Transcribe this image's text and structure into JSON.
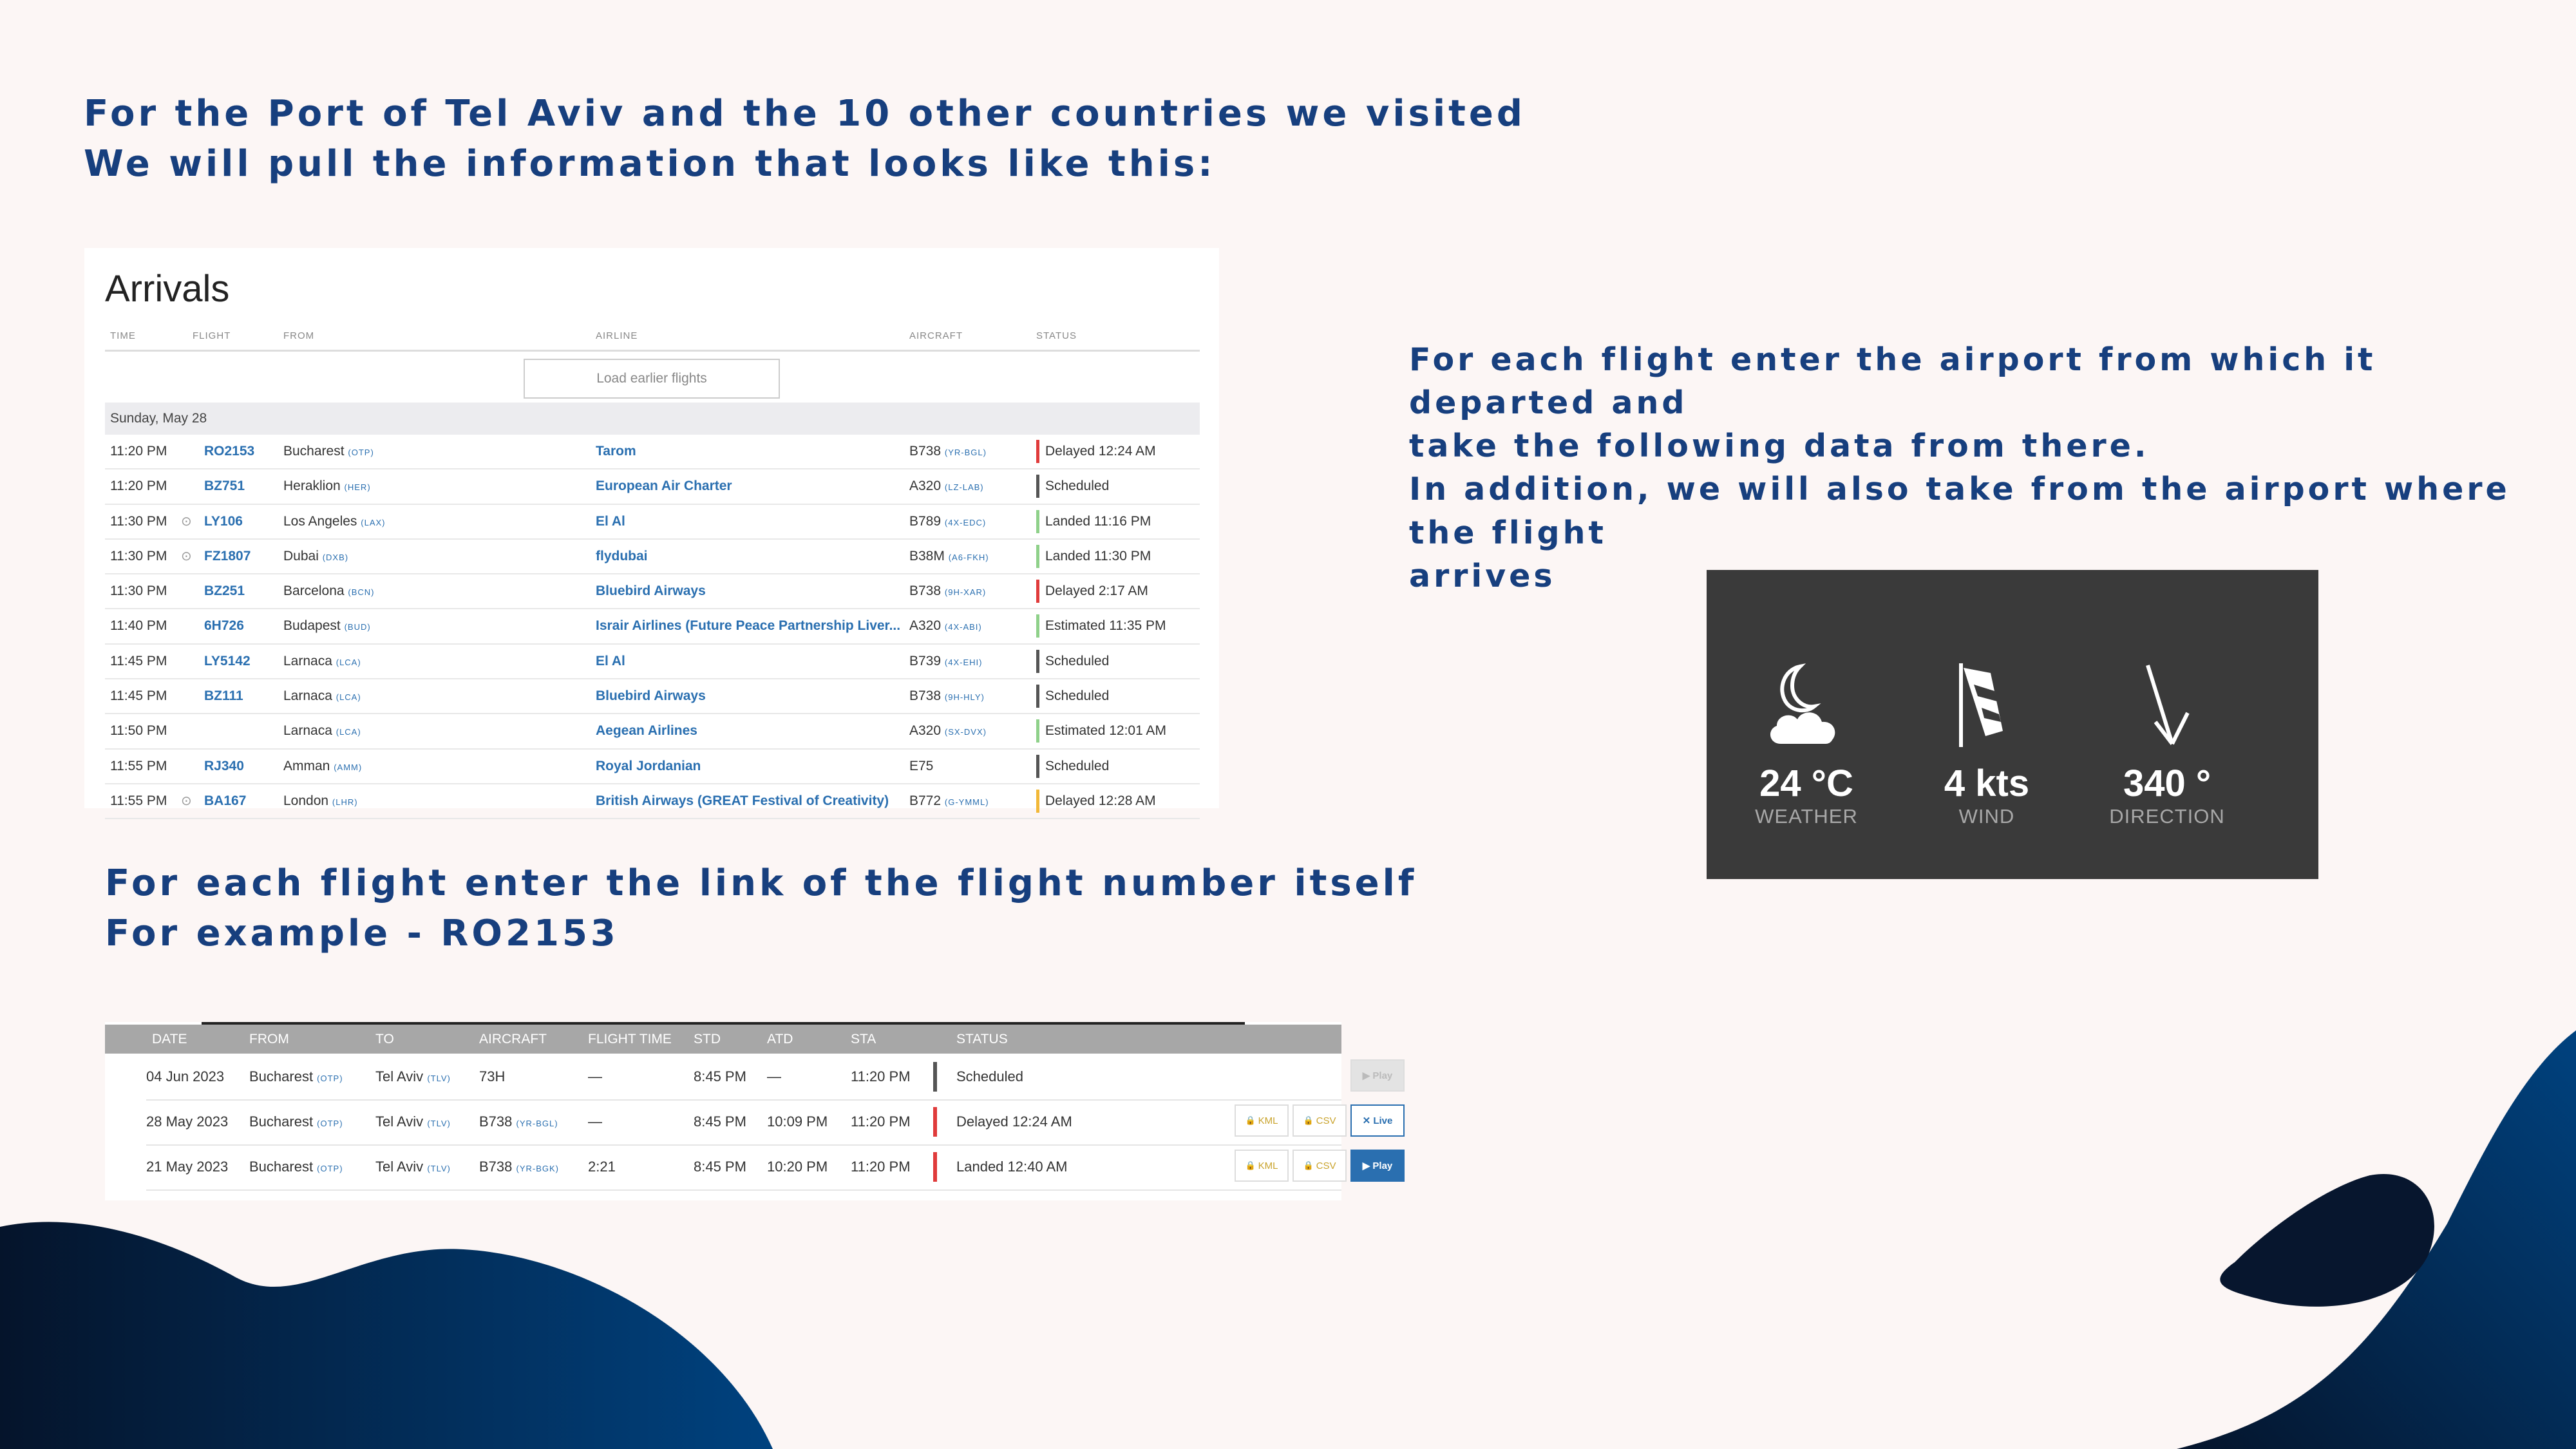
{
  "headings": {
    "top": "For the Port of Tel Aviv and the 10 other countries we visited\nWe will pull the information that looks like this:",
    "middle": "For each flight enter the link of the flight number itself\nFor example - RO2153",
    "right": "For each flight enter the airport from which it departed and\ntake the following data from there.\nIn addition, we will also take from the airport where the flight\narrives"
  },
  "arrivals": {
    "title": "Arrivals",
    "columns": [
      "TIME",
      "FLIGHT",
      "FROM",
      "AIRLINE",
      "AIRCRAFT",
      "STATUS"
    ],
    "load_button": "Load earlier flights",
    "day": "Sunday, May 28",
    "rows": [
      {
        "time": "11:20 PM",
        "live": false,
        "flight": "RO2153",
        "from": "Bucharest",
        "from_code": "(OTP)",
        "airline": "Tarom",
        "aircraft": "B738",
        "reg": "(YR-BGL)",
        "status": "Delayed 12:24 AM",
        "status_color": "#e03b3b"
      },
      {
        "time": "11:20 PM",
        "live": false,
        "flight": "BZ751",
        "from": "Heraklion",
        "from_code": "(HER)",
        "airline": "European Air Charter",
        "aircraft": "A320",
        "reg": "(LZ-LAB)",
        "status": "Scheduled",
        "status_color": "#555555"
      },
      {
        "time": "11:30 PM",
        "live": true,
        "flight": "LY106",
        "from": "Los Angeles",
        "from_code": "(LAX)",
        "airline": "El Al",
        "aircraft": "B789",
        "reg": "(4X-EDC)",
        "status": "Landed 11:16 PM",
        "status_color": "#8fd18a"
      },
      {
        "time": "11:30 PM",
        "live": true,
        "flight": "FZ1807",
        "from": "Dubai",
        "from_code": "(DXB)",
        "airline": "flydubai",
        "aircraft": "B38M",
        "reg": "(A6-FKH)",
        "status": "Landed 11:30 PM",
        "status_color": "#8fd18a"
      },
      {
        "time": "11:30 PM",
        "live": false,
        "flight": "BZ251",
        "from": "Barcelona",
        "from_code": "(BCN)",
        "airline": "Bluebird Airways",
        "aircraft": "B738",
        "reg": "(9H-XAR)",
        "status": "Delayed 2:17 AM",
        "status_color": "#e03b3b"
      },
      {
        "time": "11:40 PM",
        "live": false,
        "flight": "6H726",
        "from": "Budapest",
        "from_code": "(BUD)",
        "airline": "Israir Airlines (Future Peace Partnership Liver...",
        "aircraft": "A320",
        "reg": "(4X-ABI)",
        "status": "Estimated 11:35 PM",
        "status_color": "#8fd18a"
      },
      {
        "time": "11:45 PM",
        "live": false,
        "flight": "LY5142",
        "from": "Larnaca",
        "from_code": "(LCA)",
        "airline": "El Al",
        "aircraft": "B739",
        "reg": "(4X-EHI)",
        "status": "Scheduled",
        "status_color": "#555555"
      },
      {
        "time": "11:45 PM",
        "live": false,
        "flight": "BZ111",
        "from": "Larnaca",
        "from_code": "(LCA)",
        "airline": "Bluebird Airways",
        "aircraft": "B738",
        "reg": "(9H-HLY)",
        "status": "Scheduled",
        "status_color": "#555555"
      },
      {
        "time": "11:50 PM",
        "live": false,
        "flight": "",
        "from": "Larnaca",
        "from_code": "(LCA)",
        "airline": "Aegean Airlines",
        "aircraft": "A320",
        "reg": "(SX-DVX)",
        "status": "Estimated 12:01 AM",
        "status_color": "#8fd18a"
      },
      {
        "time": "11:55 PM",
        "live": false,
        "flight": "RJ340",
        "from": "Amman",
        "from_code": "(AMM)",
        "airline": "Royal Jordanian",
        "aircraft": "E75",
        "reg": "",
        "status": "Scheduled",
        "status_color": "#555555"
      },
      {
        "time": "11:55 PM",
        "live": true,
        "flight": "BA167",
        "from": "London",
        "from_code": "(LHR)",
        "airline": "British Airways (GREAT Festival of Creativity)",
        "aircraft": "B772",
        "reg": "(G-YMML)",
        "status": "Delayed 12:28 AM",
        "status_color": "#f2b838"
      }
    ]
  },
  "weather": {
    "items": [
      {
        "icon": "moon-cloud-icon",
        "value": "24 °C",
        "label": "WEATHER"
      },
      {
        "icon": "windsock-icon",
        "value": "4 kts",
        "label": "WIND"
      },
      {
        "icon": "arrow-down-left-icon",
        "value": "340 °",
        "label": "DIRECTION"
      }
    ]
  },
  "history": {
    "columns": [
      "DATE",
      "FROM",
      "TO",
      "AIRCRAFT",
      "FLIGHT TIME",
      "STD",
      "ATD",
      "STA",
      "STATUS"
    ],
    "rows": [
      {
        "date": "04 Jun 2023",
        "from": "Bucharest",
        "from_code": "(OTP)",
        "to": "Tel Aviv",
        "to_code": "(TLV)",
        "aircraft": "73H",
        "reg": "",
        "flight_time": "—",
        "std": "8:45 PM",
        "atd": "—",
        "sta": "11:20 PM",
        "status": "Scheduled",
        "status_color": "#555555",
        "kml": "",
        "csv": "",
        "action": "▶ Play",
        "action_style": "disabled"
      },
      {
        "date": "28 May 2023",
        "from": "Bucharest",
        "from_code": "(OTP)",
        "to": "Tel Aviv",
        "to_code": "(TLV)",
        "aircraft": "B738",
        "reg": "(YR-BGL)",
        "flight_time": "—",
        "std": "8:45 PM",
        "atd": "10:09 PM",
        "sta": "11:20 PM",
        "status": "Delayed 12:24 AM",
        "status_color": "#e03b3b",
        "kml": "KML",
        "csv": "CSV",
        "action": "✕ Live",
        "action_style": "outline"
      },
      {
        "date": "21 May 2023",
        "from": "Bucharest",
        "from_code": "(OTP)",
        "to": "Tel Aviv",
        "to_code": "(TLV)",
        "aircraft": "B738",
        "reg": "(YR-BGK)",
        "flight_time": "2:21",
        "std": "8:45 PM",
        "atd": "10:20 PM",
        "sta": "11:20 PM",
        "status": "Landed 12:40 AM",
        "status_color": "#e03b3b",
        "kml": "KML",
        "csv": "CSV",
        "action": "▶ Play",
        "action_style": "filled"
      }
    ]
  },
  "colors": {
    "background": "#fcf6f5",
    "heading": "#173f7e",
    "link": "#2a6fb0",
    "blob_dark": "#05142b",
    "blob_blue": "#003a76"
  }
}
